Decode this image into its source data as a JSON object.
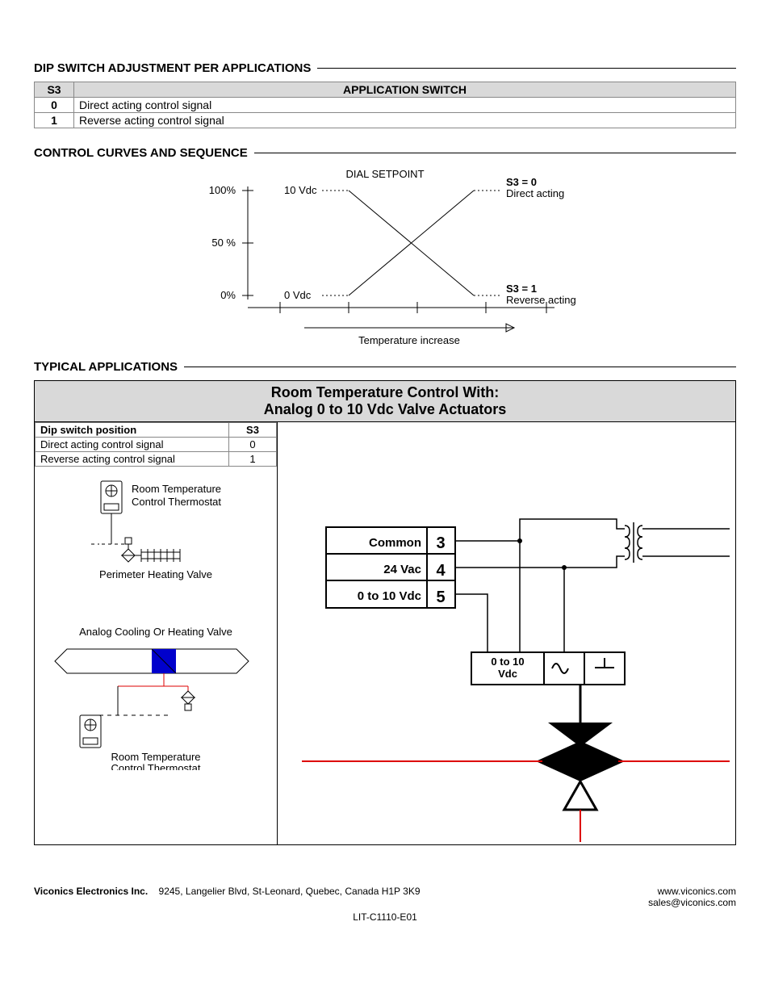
{
  "headings": {
    "dip": "DIP SWITCH ADJUSTMENT PER APPLICATIONS",
    "curves": "CONTROL CURVES AND SEQUENCE",
    "typical": "TYPICAL APPLICATIONS"
  },
  "dip_table": {
    "col_s3": "S3",
    "col_app": "APPLICATION SWITCH",
    "rows": [
      {
        "s3": "0",
        "desc": "Direct acting control signal"
      },
      {
        "s3": "1",
        "desc": "Reverse acting control signal"
      }
    ]
  },
  "chart": {
    "dial_setpoint": "DIAL SETPOINT",
    "y_ticks": [
      "100%",
      "50 %",
      "0%"
    ],
    "v_labels": {
      "top": "10 Vdc",
      "bottom": "0 Vdc"
    },
    "s3_0_l1": "S3 = 0",
    "s3_0_l2": "Direct acting",
    "s3_1_l1": "S3 = 1",
    "s3_1_l2": "Reverse acting",
    "x_label": "Temperature increase"
  },
  "chart_data": {
    "type": "line",
    "title": "DIAL SETPOINT",
    "xlabel": "Temperature increase",
    "ylabel": "",
    "y_ticks_pct": [
      0,
      50,
      100
    ],
    "y_ticks_vdc": [
      0,
      10
    ],
    "series": [
      {
        "name": "S3 = 0 Direct acting",
        "x": [
          0,
          1
        ],
        "y_pct": [
          0,
          100
        ]
      },
      {
        "name": "S3 = 1 Reverse acting",
        "x": [
          0,
          1
        ],
        "y_pct": [
          100,
          0
        ]
      }
    ]
  },
  "app": {
    "title_l1": "Room Temperature Control With:",
    "title_l2": "Analog 0 to 10 Vdc Valve Actuators",
    "mini_table": {
      "hdr_pos": "Dip switch position",
      "hdr_s3": "S3",
      "rows": [
        {
          "pos": "Direct acting control signal",
          "s3": "0"
        },
        {
          "pos": "Reverse acting control signal",
          "s3": "1"
        }
      ]
    },
    "therm_label": "Room Temperature\nControl Thermostat",
    "perimeter_label": "Perimeter Heating Valve",
    "analog_valve_label": "Analog Cooling Or Heating Valve",
    "therm_label2": "Room Temperature\nControl Thermostat",
    "wiring": {
      "common": "Common",
      "vac24": "24 Vac",
      "vdc010": "0 to 10 Vdc",
      "t3": "3",
      "t4": "4",
      "t5": "5",
      "act_label": "0 to 10\nVdc"
    }
  },
  "footer": {
    "company": "Viconics Electronics Inc.",
    "address": "9245, Langelier Blvd, St-Leonard, Quebec, Canada H1P 3K9",
    "web": "www.viconics.com",
    "email": "sales@viconics.com",
    "lit": "LIT-C1110-E01"
  }
}
